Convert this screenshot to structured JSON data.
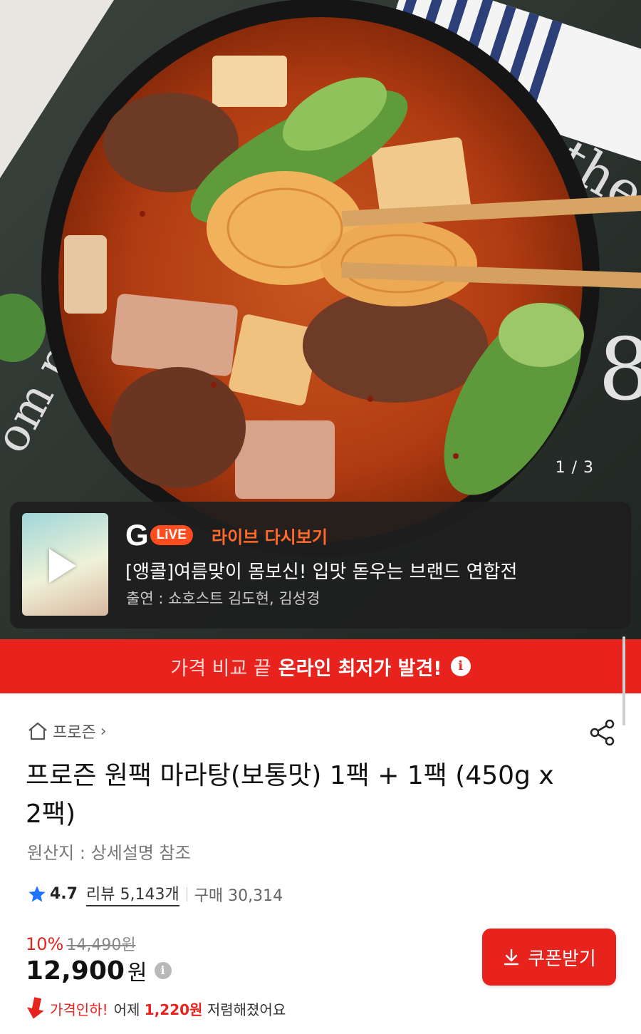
{
  "hero": {
    "page_indicator": "1 / 3"
  },
  "live": {
    "logo_letter": "G",
    "logo_pill": "LiVE",
    "replay_label": "라이브 다시보기",
    "title": "[앵콜]여름맞이 몸보신! 입맛 돋우는 브랜드 연합전",
    "cast": "출연 : 쇼호스트 김도현, 김성경"
  },
  "promo": {
    "light_text": "가격 비교 끝",
    "bold_text": "온라인 최저가 발견!",
    "info_glyph": "i"
  },
  "product": {
    "breadcrumb": "프로즌",
    "breadcrumb_chevron": "›",
    "title": "프로즌 원팩 마라탕(보통맛) 1팩 + 1팩 (450g x 2팩)",
    "origin": "원산지 : 상세설명 참조",
    "rating": "4.7",
    "reviews": "리뷰 5,143개",
    "purchases": "구매 30,314"
  },
  "price": {
    "discount_rate": "10%",
    "original_price": "14,490원",
    "price": "12,900",
    "unit": "원",
    "info_glyph": "i",
    "drop_label": "가격인하!",
    "drop_prefix": "어제",
    "drop_amount": "1,220원",
    "drop_suffix": "저렴해졌어요"
  },
  "coupon": {
    "label": "쿠폰받기"
  },
  "colors": {
    "accent_red": "#e8231e",
    "live_orange": "#ff6a2c",
    "star_blue": "#1f74ff"
  },
  "icons": {
    "home": "home-icon",
    "share": "share-icon",
    "star": "star-icon",
    "play": "play-icon",
    "download": "download-icon",
    "price_down": "arrow-down-icon"
  }
}
